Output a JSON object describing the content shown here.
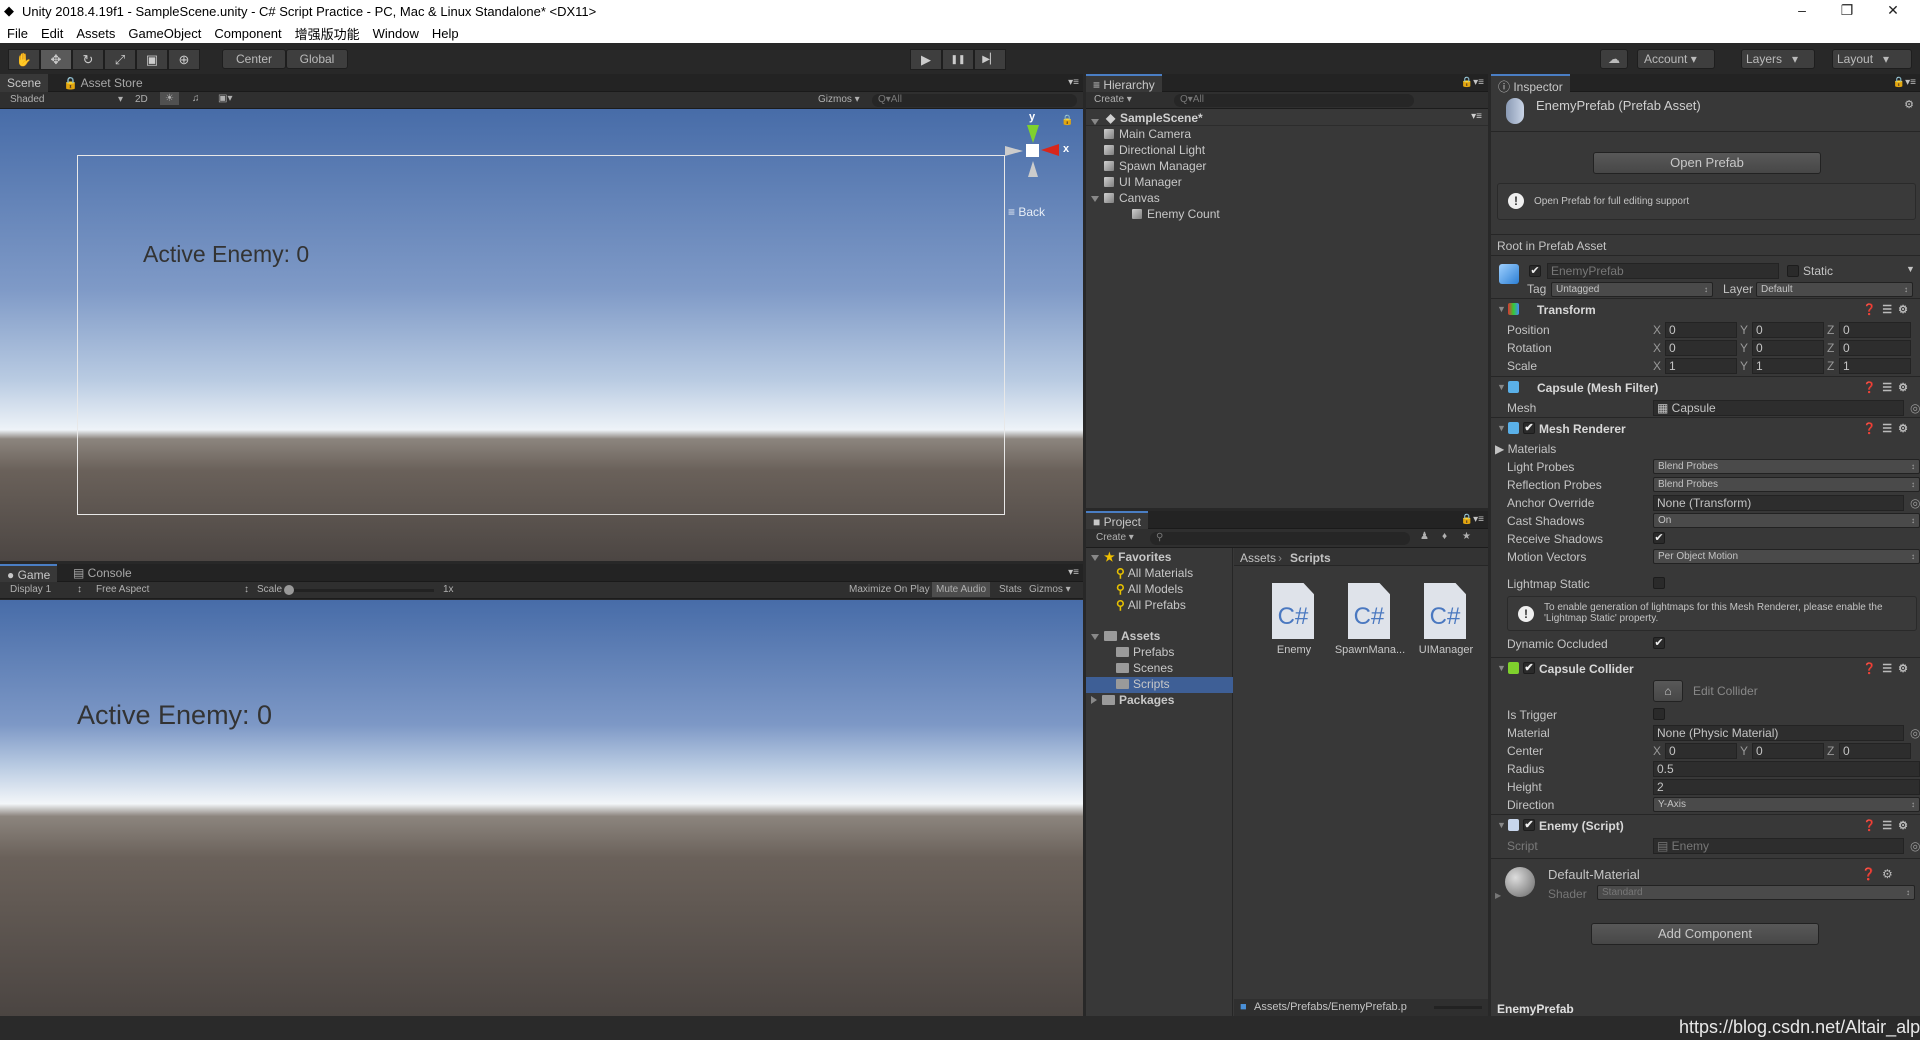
{
  "window": {
    "title": "Unity 2018.4.19f1 - SampleScene.unity - C# Script Practice - PC, Mac & Linux Standalone* <DX11>",
    "minimize": "–",
    "restore": "❐",
    "close": "✕"
  },
  "menu": [
    "File",
    "Edit",
    "Assets",
    "GameObject",
    "Component",
    "增强版功能",
    "Window",
    "Help"
  ],
  "toolbar": {
    "tools": [
      "hand-tool",
      "move-tool",
      "rotate-tool",
      "scale-tool",
      "rect-tool",
      "transform-tool"
    ],
    "tool_glyphs": [
      "✋",
      "✥",
      "↻",
      "⤢",
      "▣",
      "⊕"
    ],
    "active_tool": 1,
    "pivot": "Center",
    "space": "Global",
    "play": "▶",
    "pause": "❚❚",
    "step": "▶▏",
    "collab_glyph": "☁",
    "account": "Account",
    "layers": "Layers",
    "layout": "Layout"
  },
  "scene": {
    "tabs": [
      "Scene",
      "Asset Store"
    ],
    "shading": "Shaded",
    "mode_2d": "2D",
    "gizmos": "Gizmos",
    "search_placeholder": "Q▾All",
    "ui_text": "Active Enemy: 0",
    "gizmo": {
      "y": "y",
      "x": "x",
      "view_label": "Back"
    }
  },
  "game": {
    "tabs": [
      "Game",
      "Console"
    ],
    "display": "Display 1",
    "aspect": "Free Aspect",
    "scale_label": "Scale",
    "scale_value": "1x",
    "maximize": "Maximize On Play",
    "mute": "Mute Audio",
    "stats": "Stats",
    "gizmos": "Gizmos",
    "ui_text": "Active Enemy: 0"
  },
  "hierarchy": {
    "tab": "Hierarchy",
    "create": "Create ▾",
    "search_placeholder": "Q▾All",
    "scene": "SampleScene*",
    "items": [
      {
        "label": "Main Camera",
        "depth": 1
      },
      {
        "label": "Directional Light",
        "depth": 1
      },
      {
        "label": "Spawn Manager",
        "depth": 1
      },
      {
        "label": "UI Manager",
        "depth": 1
      },
      {
        "label": "Canvas",
        "depth": 1,
        "expanded": true
      },
      {
        "label": "Enemy Count",
        "depth": 2
      }
    ]
  },
  "project": {
    "tab": "Project",
    "create": "Create ▾",
    "favorites": {
      "label": "Favorites",
      "items": [
        "All Materials",
        "All Models",
        "All Prefabs"
      ]
    },
    "assets": {
      "label": "Assets",
      "items": [
        "Prefabs",
        "Scenes",
        "Scripts"
      ],
      "selected": "Scripts"
    },
    "packages": "Packages",
    "breadcrumb": [
      "Assets",
      "Scripts"
    ],
    "files": [
      {
        "name": "Enemy",
        "icon": "C#"
      },
      {
        "name": "SpawnMana...",
        "icon": "C#"
      },
      {
        "name": "UIManager",
        "icon": "C#"
      }
    ],
    "status_path": "Assets/Prefabs/EnemyPrefab.p"
  },
  "inspector": {
    "tab": "Inspector",
    "title": "EnemyPrefab (Prefab Asset)",
    "open_prefab": "Open Prefab",
    "open_help": "Open Prefab for full editing support",
    "root_label": "Root in Prefab Asset",
    "object": {
      "name": "EnemyPrefab",
      "active": true,
      "static_label": "Static",
      "static": false,
      "tag_label": "Tag",
      "tag": "Untagged",
      "layer_label": "Layer",
      "layer": "Default"
    },
    "transform": {
      "title": "Transform",
      "rows": [
        {
          "label": "Position",
          "x": "0",
          "y": "0",
          "z": "0"
        },
        {
          "label": "Rotation",
          "x": "0",
          "y": "0",
          "z": "0"
        },
        {
          "label": "Scale",
          "x": "1",
          "y": "1",
          "z": "1"
        }
      ]
    },
    "mesh_filter": {
      "title": "Capsule (Mesh Filter)",
      "mesh_label": "Mesh",
      "mesh": "Capsule"
    },
    "mesh_renderer": {
      "title": "Mesh Renderer",
      "enabled": true,
      "materials": "Materials",
      "light_probes_label": "Light Probes",
      "light_probes": "Blend Probes",
      "reflection_probes_label": "Reflection Probes",
      "reflection_probes": "Blend Probes",
      "anchor_label": "Anchor Override",
      "anchor": "None (Transform)",
      "cast_label": "Cast Shadows",
      "cast": "On",
      "receive_label": "Receive Shadows",
      "receive": true,
      "motion_label": "Motion Vectors",
      "motion": "Per Object Motion",
      "lightmap_label": "Lightmap Static",
      "lightmap": false,
      "lightmap_help_1": "To enable generation of lightmaps for this Mesh Renderer, please enable the",
      "lightmap_help_2": "'Lightmap Static' property.",
      "dynamic_label": "Dynamic Occluded",
      "dynamic": true
    },
    "capsule_collider": {
      "title": "Capsule Collider",
      "enabled": true,
      "edit": "Edit Collider",
      "trigger_label": "Is Trigger",
      "trigger": false,
      "material_label": "Material",
      "material": "None (Physic Material)",
      "center_label": "Center",
      "center": {
        "x": "0",
        "y": "0",
        "z": "0"
      },
      "radius_label": "Radius",
      "radius": "0.5",
      "height_label": "Height",
      "height": "2",
      "direction_label": "Direction",
      "direction": "Y-Axis"
    },
    "script": {
      "title": "Enemy (Script)",
      "enabled": true,
      "script_label": "Script",
      "script": "Enemy"
    },
    "material": {
      "name": "Default-Material",
      "shader_label": "Shader",
      "shader": "Standard"
    },
    "add_component": "Add Component",
    "footer": "EnemyPrefab"
  },
  "watermark": "https://blog.csdn.net/Altair_alpha",
  "colors": {
    "accent": "#4a7ec4",
    "selection": "#3e5f96",
    "panel": "#383838",
    "axis_x": "#d8261b",
    "axis_y": "#7fd12d"
  }
}
